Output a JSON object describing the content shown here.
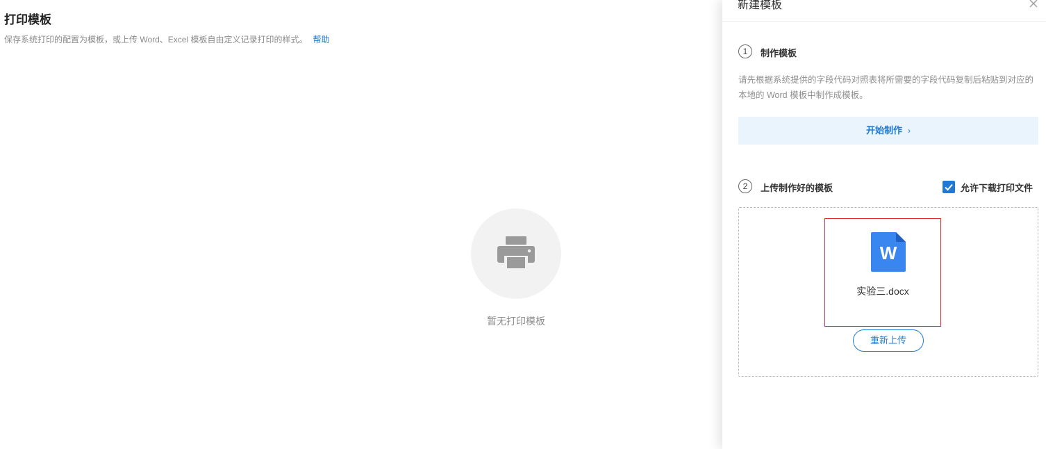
{
  "page": {
    "title": "打印模板",
    "description": "保存系统打印的配置为模板，或上传 Word、Excel 模板自由定义记录打印的样式。",
    "help_link": "帮助",
    "empty_text": "暂无打印模板",
    "empty_icon": "printer-icon"
  },
  "drawer": {
    "title": "新建模板",
    "close_icon": "close-icon",
    "step1": {
      "number": "1",
      "title": "制作模板",
      "description": "请先根据系统提供的字段代码对照表将所需要的字段代码复制后粘贴到对应的本地的 Word 模板中制作成模板。",
      "button_label": "开始制作",
      "button_chevron": "›"
    },
    "step2": {
      "number": "2",
      "title": "上传制作好的模板",
      "allow_download_label": "允许下载打印文件",
      "allow_download_checked": true,
      "file": {
        "icon": "word-file-icon",
        "icon_letter": "W",
        "name": "实验三.docx"
      },
      "reupload_label": "重新上传"
    }
  },
  "colors": {
    "accent": "#1f7ad6",
    "accent_light": "#eaf4fd",
    "word_blue": "#3a86f0",
    "highlight_border": "#d9262c"
  }
}
